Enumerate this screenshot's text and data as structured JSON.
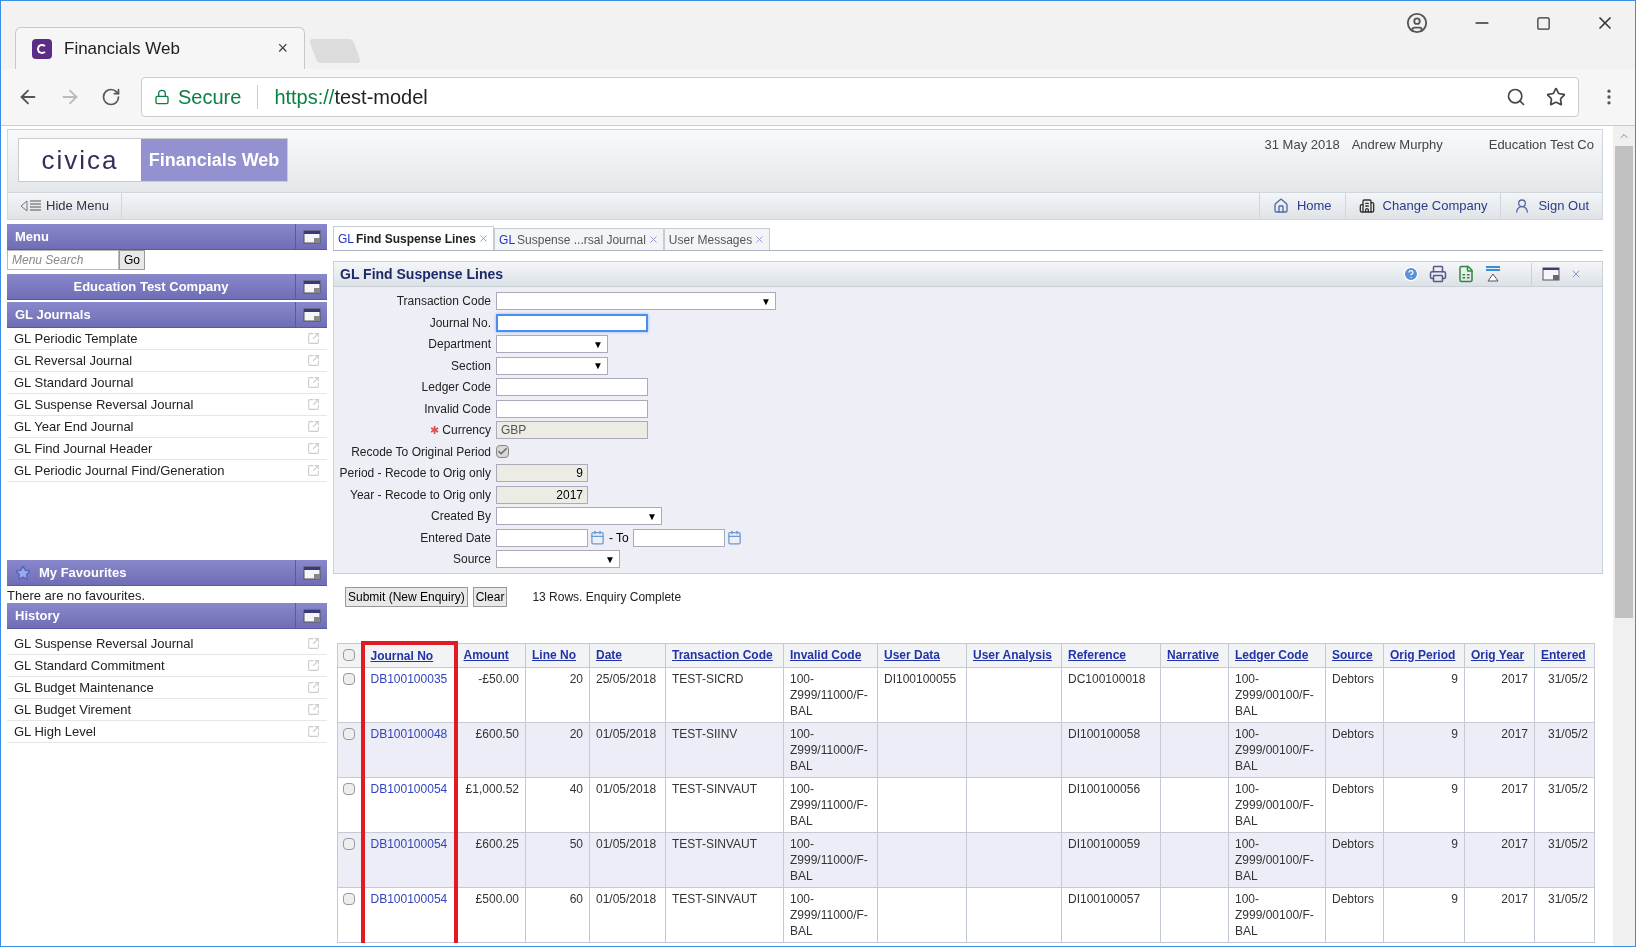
{
  "browser": {
    "tab_title": "Financials Web",
    "tab_close": "×",
    "secure_label": "Secure",
    "url_scheme": "https://",
    "url_host": "test-model"
  },
  "header": {
    "logo": "civica",
    "product": "Financials Web",
    "date": "31 May 2018",
    "user": "Andrew Murphy",
    "company": "Education Test Co"
  },
  "navbar": {
    "hide_menu": "Hide Menu",
    "links": [
      {
        "kind": "home",
        "label": "Home"
      },
      {
        "kind": "company",
        "label": "Change Company"
      },
      {
        "kind": "signout",
        "label": "Sign Out"
      }
    ]
  },
  "sidebar": {
    "menu_title": "Menu",
    "search_placeholder": "Menu Search",
    "go": "Go",
    "company": "Education Test Company",
    "journals_title": "GL Journals",
    "journals": [
      "GL Periodic Template",
      "GL Reversal Journal",
      "GL Standard Journal",
      "GL Suspense Reversal Journal",
      "GL Year End Journal",
      "GL Find Journal Header",
      "GL Periodic Journal Find/Generation"
    ],
    "favourites_title": "My Favourites",
    "favourites_empty": "There are no favourites.",
    "history_title": "History",
    "history": [
      "GL Suspense Reversal Journal",
      "GL Standard Commitment",
      "GL Budget Maintenance",
      "GL Budget Virement",
      "GL High Level"
    ]
  },
  "tabs": [
    {
      "prefix": "GL",
      "label": "Find Suspense Lines",
      "selected": true
    },
    {
      "prefix": "GL",
      "label": "Suspense ...rsal Journal",
      "selected": false
    },
    {
      "label": "User Messages",
      "selected": false
    }
  ],
  "panel": {
    "title": "GL Find Suspense Lines",
    "fields": [
      {
        "kind": "select",
        "label": "Transaction Code",
        "arrow": "▼"
      },
      {
        "kind": "text",
        "label": "Journal No.",
        "focused": true
      },
      {
        "kind": "select",
        "label": "Department",
        "arrow": "▼"
      },
      {
        "kind": "select",
        "label": "Section",
        "arrow": "▼"
      },
      {
        "kind": "text",
        "label": "Ledger Code",
        "focused": false
      },
      {
        "kind": "text",
        "label": "Invalid Code",
        "focused": false
      },
      {
        "kind": "readonly",
        "label": "Currency",
        "value": "GBP",
        "required_mark": "✱"
      },
      {
        "kind": "checkbox",
        "label": "Recode To Original Period",
        "checked": true
      },
      {
        "kind": "number",
        "label": "Period - Recode to Orig only",
        "value": "9"
      },
      {
        "kind": "number",
        "label": "Year - Recode to Orig only",
        "value": "2017"
      },
      {
        "kind": "select",
        "label": "Created By",
        "arrow": "▼"
      },
      {
        "kind": "daterange",
        "label": "Entered Date",
        "to": "- To"
      },
      {
        "kind": "select",
        "label": "Source",
        "arrow": "▼"
      }
    ],
    "submit": "Submit (New Enquiry)",
    "clear": "Clear",
    "status": "13 Rows. Enquiry Complete"
  },
  "table": {
    "select_all_checked": false,
    "columns": [
      {
        "label": "Journal No",
        "highlighted": true
      },
      {
        "label": "Amount",
        "highlighted": false
      },
      {
        "label": "Line No",
        "highlighted": false
      },
      {
        "label": "Date",
        "highlighted": false
      },
      {
        "label": "Transaction Code",
        "highlighted": false
      },
      {
        "label": "Invalid Code",
        "highlighted": false
      },
      {
        "label": "User Data",
        "highlighted": false
      },
      {
        "label": "User Analysis",
        "highlighted": false
      },
      {
        "label": "Reference",
        "highlighted": false
      },
      {
        "label": "Narrative",
        "highlighted": false
      },
      {
        "label": "Ledger Code",
        "highlighted": false
      },
      {
        "label": "Source",
        "highlighted": false
      },
      {
        "label": "Orig Period",
        "highlighted": false
      },
      {
        "label": "Orig Year",
        "highlighted": false
      },
      {
        "label": "Entered",
        "highlighted": false
      }
    ],
    "rows": [
      {
        "checked": false,
        "cells": [
          "DB100100035",
          "-£50.00",
          "20",
          "25/05/2018",
          "TEST-SICRD",
          "100-Z999/11000/F-BAL",
          "DI100100055",
          "",
          "DC100100018",
          "",
          "100-Z999/00100/F-BAL",
          "Debtors",
          "9",
          "2017",
          "31/05/2"
        ]
      },
      {
        "checked": false,
        "cells": [
          "DB100100048",
          "£600.50",
          "20",
          "01/05/2018",
          "TEST-SIINV",
          "100-Z999/11000/F-BAL",
          "",
          "",
          "DI100100058",
          "",
          "100-Z999/00100/F-BAL",
          "Debtors",
          "9",
          "2017",
          "31/05/2"
        ]
      },
      {
        "checked": false,
        "cells": [
          "DB100100054",
          "£1,000.52",
          "40",
          "01/05/2018",
          "TEST-SINVAUT",
          "100-Z999/11000/F-BAL",
          "",
          "",
          "DI100100056",
          "",
          "100-Z999/00100/F-BAL",
          "Debtors",
          "9",
          "2017",
          "31/05/2"
        ]
      },
      {
        "checked": false,
        "cells": [
          "DB100100054",
          "£600.25",
          "50",
          "01/05/2018",
          "TEST-SINVAUT",
          "100-Z999/11000/F-BAL",
          "",
          "",
          "DI100100059",
          "",
          "100-Z999/00100/F-BAL",
          "Debtors",
          "9",
          "2017",
          "31/05/2"
        ]
      },
      {
        "checked": false,
        "cells": [
          "DB100100054",
          "£500.00",
          "60",
          "01/05/2018",
          "TEST-SINVAUT",
          "100-Z999/11000/F-BAL",
          "",
          "",
          "DI100100057",
          "",
          "100-Z999/00100/F-BAL",
          "Debtors",
          "9",
          "2017",
          "31/05/2"
        ]
      }
    ]
  }
}
